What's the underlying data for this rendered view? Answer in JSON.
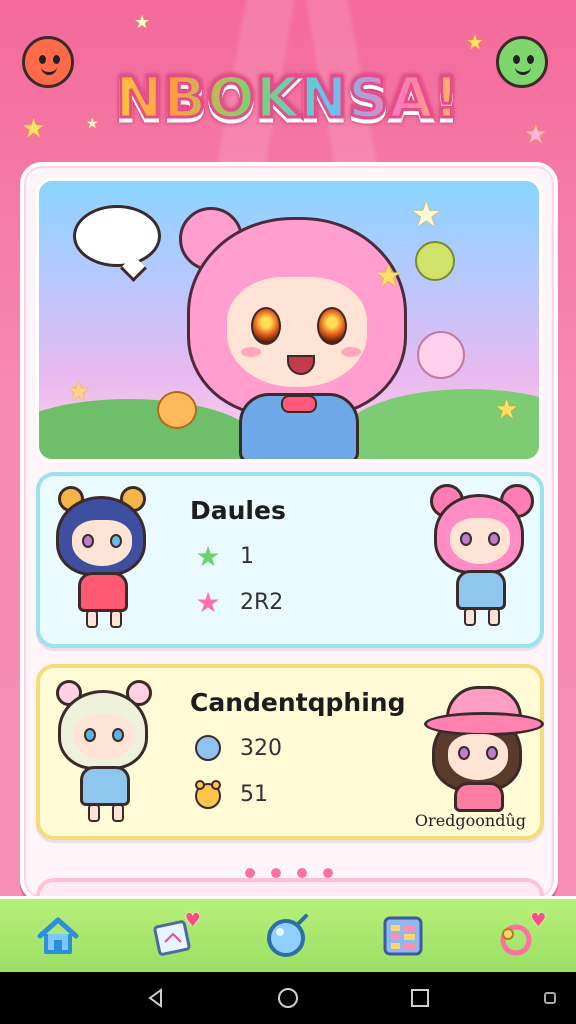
{
  "app": {
    "title": "NBOKNSA!"
  },
  "cards": [
    {
      "title": "Daules",
      "stats": [
        {
          "icon": "green-star-icon",
          "value": "1"
        },
        {
          "icon": "pink-star-icon",
          "value": "2R2"
        }
      ]
    },
    {
      "title": "Candentqphing",
      "stats": [
        {
          "icon": "blue-orb-icon",
          "value": "320"
        },
        {
          "icon": "yellow-creature-icon",
          "value": "51"
        }
      ],
      "signature": "Oredgoondûg"
    }
  ],
  "pagination": {
    "count": 4
  },
  "bottom_nav": [
    {
      "icon": "home-icon"
    },
    {
      "icon": "photo-card-icon"
    },
    {
      "icon": "mirror-icon"
    },
    {
      "icon": "grid-menu-icon"
    },
    {
      "icon": "ring-icon"
    }
  ],
  "colors": {
    "background": "#f46a9b",
    "nav_green": "#9ae064",
    "card_blue": "#e9fbff",
    "card_yellow": "#fffbd6",
    "accent_pink": "#ff6fa3"
  }
}
